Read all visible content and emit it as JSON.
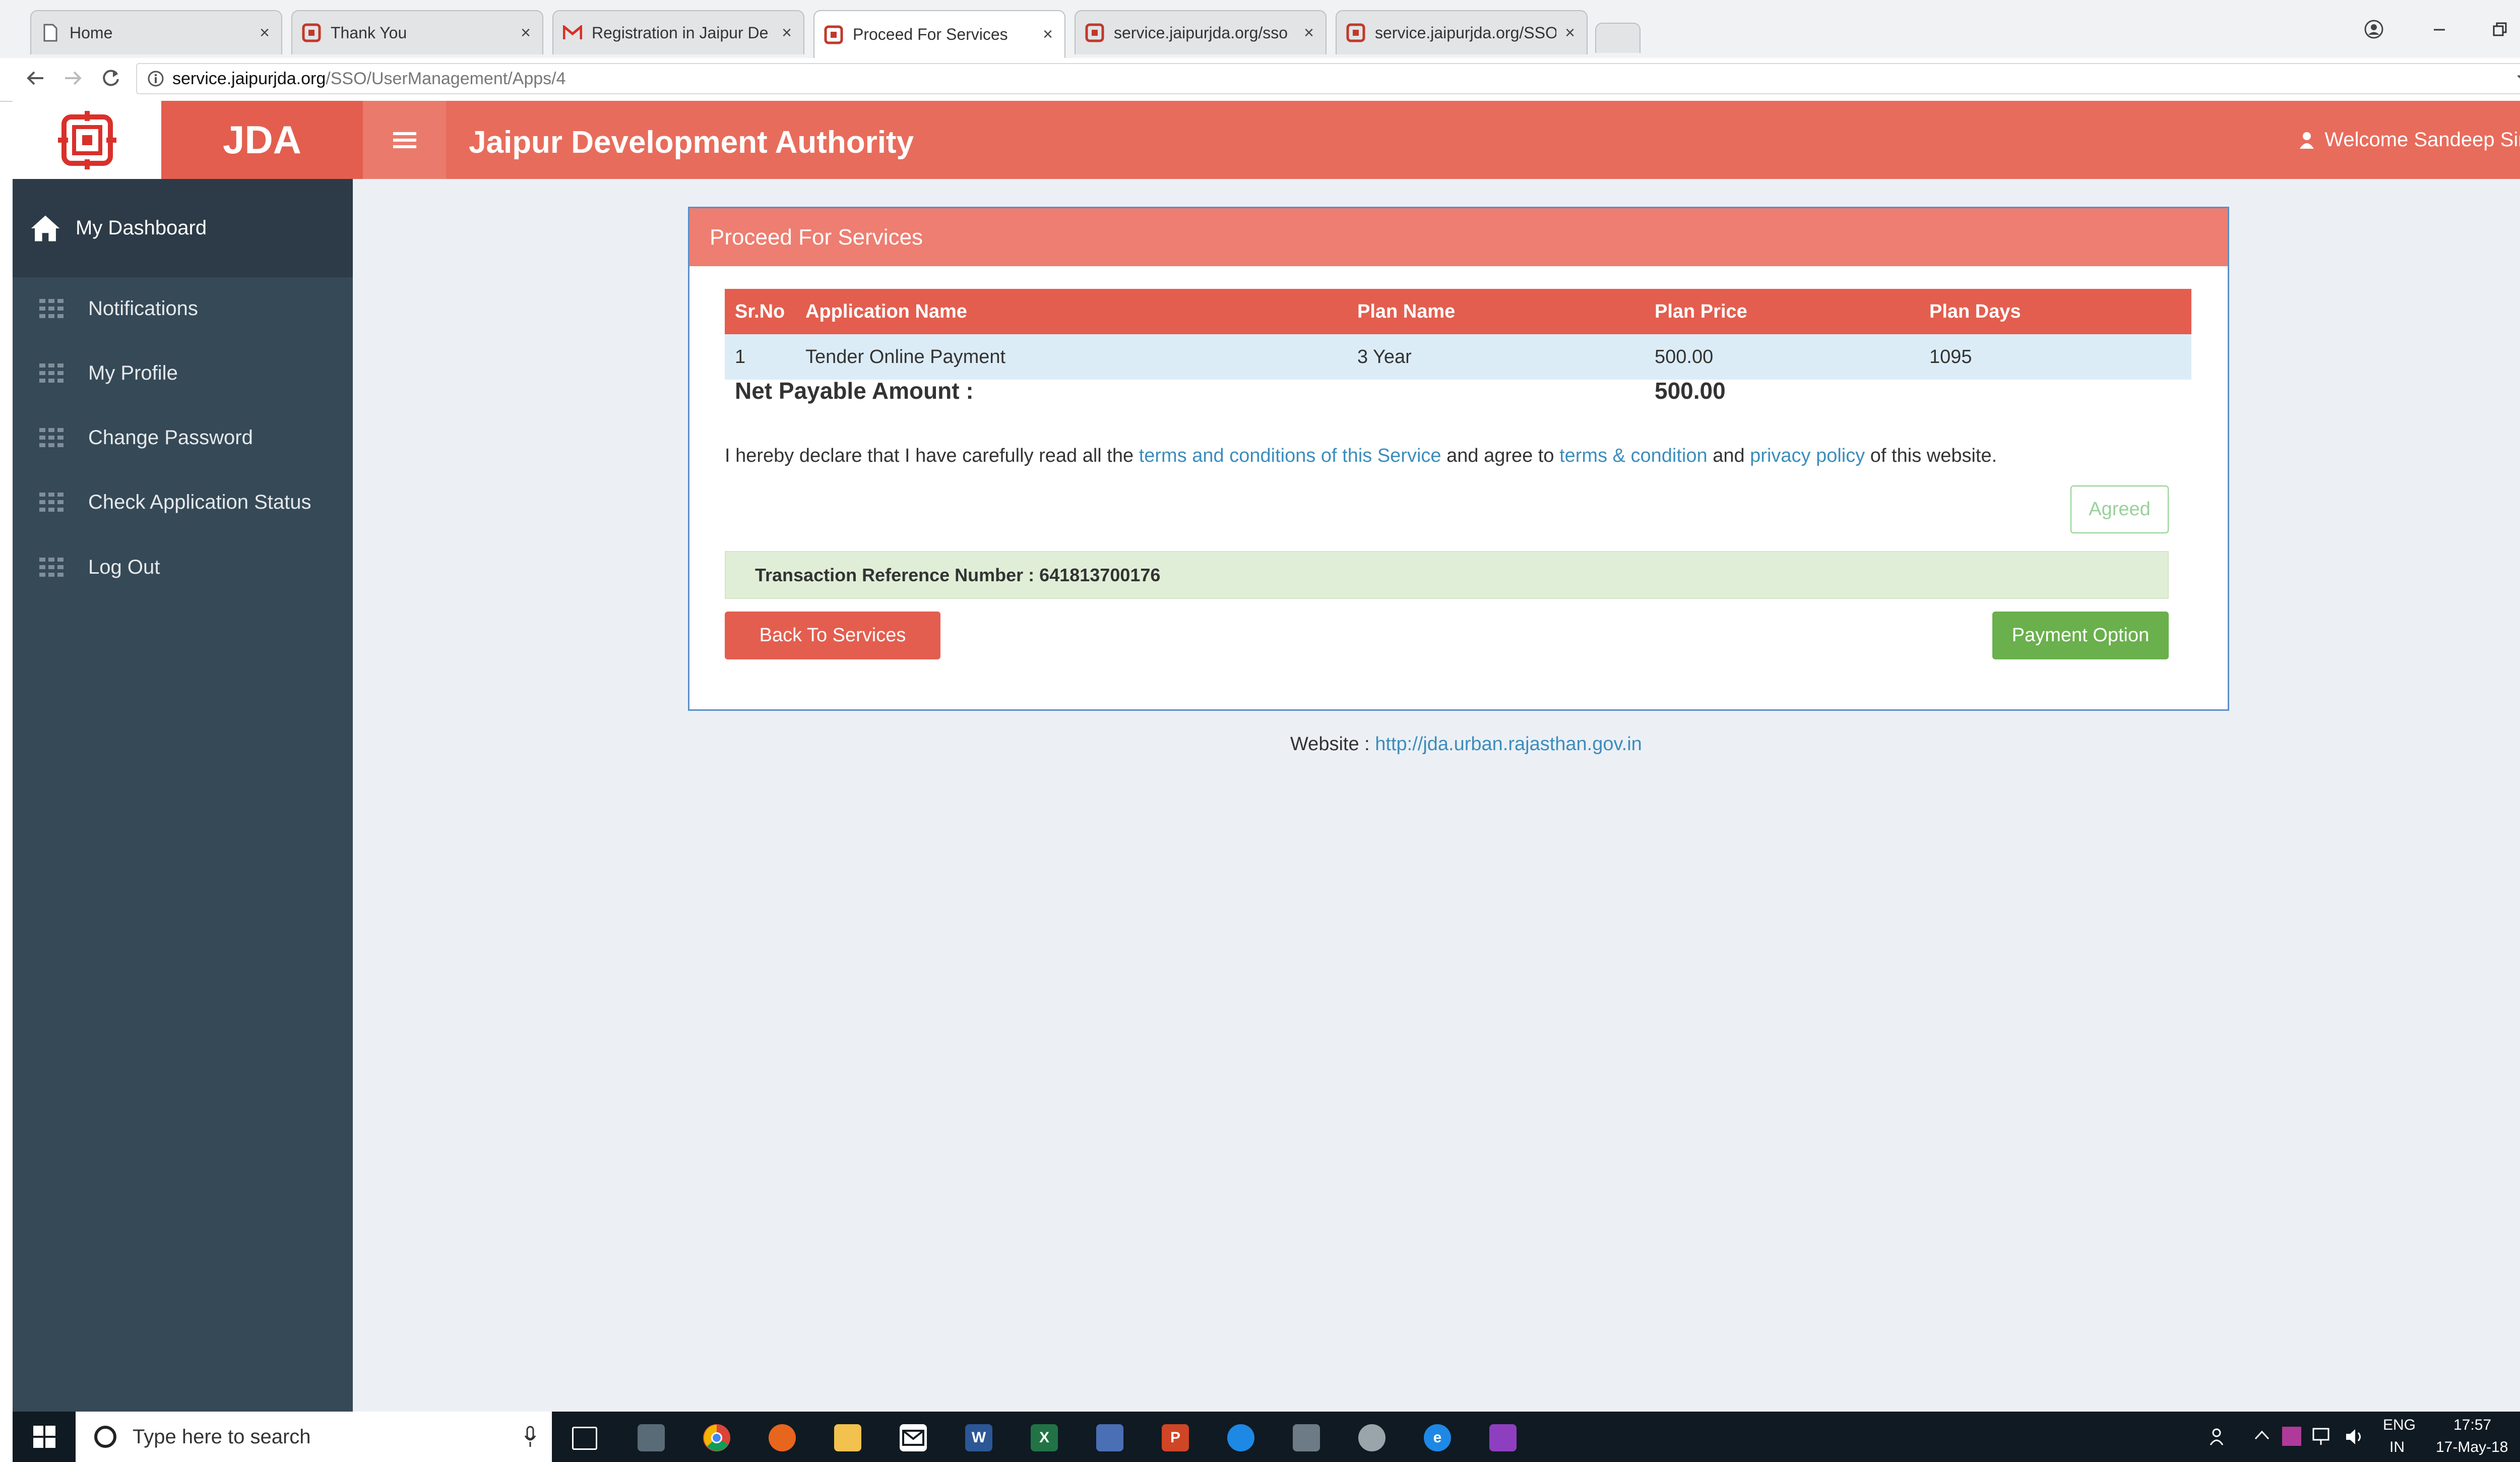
{
  "browser": {
    "tabs": [
      {
        "title": "Home",
        "icon": "page-icon"
      },
      {
        "title": "Thank You",
        "icon": "jda-favicon"
      },
      {
        "title": "Registration in Jaipur De",
        "icon": "gmail-icon"
      },
      {
        "title": "Proceed For Services",
        "icon": "jda-favicon",
        "active": true
      },
      {
        "title": "service.jaipurjda.org/sso",
        "icon": "jda-favicon"
      },
      {
        "title": "service.jaipurjda.org/SSO",
        "icon": "jda-favicon"
      }
    ],
    "close_glyph": "×",
    "url_host": "service.jaipurjda.org",
    "url_path": "/SSO/UserManagement/Apps/4"
  },
  "header": {
    "brand": "JDA",
    "title": "Jaipur Development Authority",
    "welcome": "Welcome Sandeep Singh"
  },
  "sidebar": {
    "items": [
      {
        "label": "My Dashboard",
        "icon": "home-icon"
      },
      {
        "label": "Notifications",
        "icon": "grid-icon"
      },
      {
        "label": "My Profile",
        "icon": "grid-icon"
      },
      {
        "label": "Change Password",
        "icon": "grid-icon"
      },
      {
        "label": "Check Application Status",
        "icon": "grid-icon"
      },
      {
        "label": "Log Out",
        "icon": "grid-icon"
      }
    ]
  },
  "panel": {
    "heading": "Proceed For Services",
    "table": {
      "headers": [
        "Sr.No",
        "Application Name",
        "Plan Name",
        "Plan Price",
        "Plan Days"
      ],
      "rows": [
        [
          "1",
          "Tender Online Payment",
          "3 Year",
          "500.00",
          "1095"
        ]
      ]
    },
    "net_label": "Net Payable Amount :",
    "net_value": "500.00",
    "declaration": {
      "part1": "I hereby declare that I have carefully read all the ",
      "link1": "terms and conditions of this Service",
      "part2": " and agree to ",
      "link2": "terms & condition",
      "part3": " and ",
      "link3": "privacy policy",
      "part4": " of this website."
    },
    "agreed_label": "Agreed",
    "transaction_label": "Transaction Reference Number : 641813700176",
    "back_label": "Back To Services",
    "payment_label": "Payment Option"
  },
  "footer": {
    "label": "Website : ",
    "link": "http://jda.urban.rajasthan.gov.in"
  },
  "taskbar": {
    "search_placeholder": "Type here to search",
    "lang_top": "ENG",
    "lang_bottom": "IN",
    "time": "17:57",
    "date": "17-May-18"
  },
  "colors": {
    "accent": "#e86c5c",
    "sidebar": "#364957",
    "success": "#6ab04c",
    "link": "#3c8dbc"
  }
}
